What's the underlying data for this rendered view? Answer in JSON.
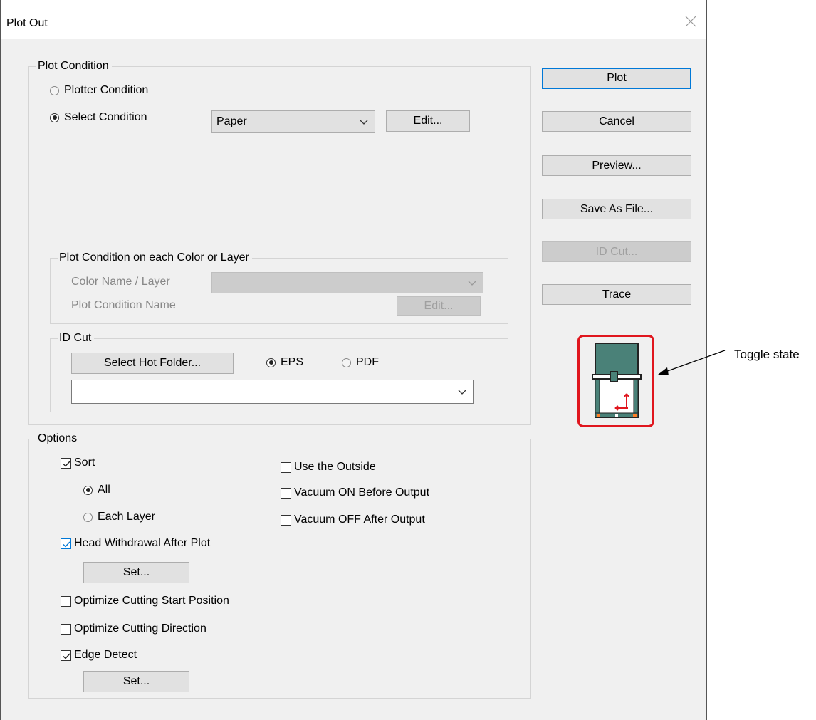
{
  "window": {
    "title": "Plot Out"
  },
  "plot_condition": {
    "legend": "Plot Condition",
    "plotter_condition": {
      "label": "Plotter Condition",
      "selected": false
    },
    "select_condition": {
      "label": "Select Condition",
      "selected": true
    },
    "condition_value": "Paper",
    "edit_label": "Edit...",
    "per_color": {
      "legend": "Plot Condition on each Color or Layer",
      "color_layer_label": "Color Name / Layer",
      "condition_name_label": "Plot Condition Name",
      "color_layer_value": "",
      "edit_label": "Edit..."
    },
    "id_cut": {
      "legend": "ID Cut",
      "select_hot_folder_label": "Select Hot Folder...",
      "eps": {
        "label": "EPS",
        "selected": true
      },
      "pdf": {
        "label": "PDF",
        "selected": false
      },
      "folder_value": ""
    }
  },
  "options": {
    "legend": "Options",
    "sort": {
      "label": "Sort",
      "checked": true
    },
    "all": {
      "label": "All",
      "selected": true
    },
    "each_layer": {
      "label": "Each Layer",
      "selected": false
    },
    "head_withdrawal": {
      "label": "Head Withdrawal After Plot",
      "checked": true
    },
    "head_set_label": "Set...",
    "optimize_start": {
      "label": "Optimize Cutting Start Position",
      "checked": false
    },
    "optimize_direction": {
      "label": "Optimize Cutting Direction",
      "checked": false
    },
    "edge_detect": {
      "label": "Edge Detect",
      "checked": true
    },
    "edge_set_label": "Set...",
    "use_outside": {
      "label": "Use the Outside",
      "checked": false
    },
    "vacuum_on": {
      "label": "Vacuum ON Before Output",
      "checked": false
    },
    "vacuum_off": {
      "label": "Vacuum OFF After Output",
      "checked": false
    }
  },
  "actions": {
    "plot": "Plot",
    "cancel": "Cancel",
    "preview": "Preview...",
    "save_as_file": "Save As File...",
    "id_cut": "ID Cut...",
    "trace": "Trace"
  },
  "annotation": {
    "label": "Toggle state"
  },
  "colors": {
    "highlight": "#e0161e",
    "plotter_teal": "#4a8178",
    "accent": "#0078d7"
  }
}
